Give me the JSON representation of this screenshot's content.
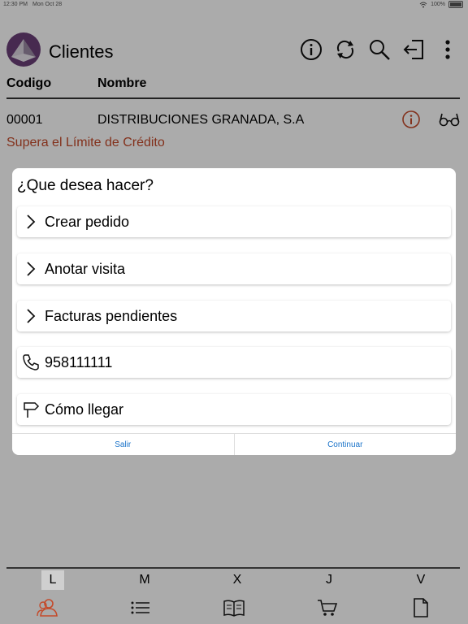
{
  "status_bar": {
    "time": "12:30 PM",
    "date": "Mon Oct 28",
    "battery": "100%"
  },
  "header": {
    "title": "Clientes",
    "icons": [
      "info-icon",
      "sync-icon",
      "search-icon",
      "logout-icon",
      "more-vertical-icon"
    ]
  },
  "columns": {
    "code": "Codigo",
    "name": "Nombre"
  },
  "rows": [
    {
      "code": "00001",
      "name": "DISTRIBUCIONES GRANADA, S.A",
      "warning": "Supera el Límite de Crédito"
    }
  ],
  "dialog": {
    "title": "¿Que desea hacer?",
    "options": [
      {
        "icon": "chevron-right-icon",
        "label": "Crear pedido"
      },
      {
        "icon": "chevron-right-icon",
        "label": "Anotar visita"
      },
      {
        "icon": "chevron-right-icon",
        "label": "Facturas pendientes"
      },
      {
        "icon": "phone-icon",
        "label": "958111111"
      },
      {
        "icon": "signpost-icon",
        "label": "Cómo llegar"
      }
    ],
    "buttons": {
      "exit": "Salir",
      "continue": "Continuar"
    }
  },
  "days": [
    "L",
    "M",
    "X",
    "J",
    "V"
  ],
  "active_day": "L",
  "tabs": [
    "clients-icon",
    "list-icon",
    "catalog-icon",
    "cart-icon",
    "document-icon"
  ],
  "colors": {
    "accent": "#c44a2a",
    "link": "#1a73c9",
    "logo": "#6b3f78"
  }
}
